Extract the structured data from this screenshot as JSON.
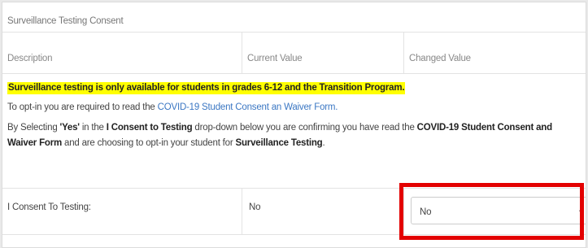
{
  "panel": {
    "title": "Surveillance Testing Consent"
  },
  "table_header": {
    "description": "Description",
    "current_value": "Current Value",
    "changed_value": "Changed Value"
  },
  "notice": "Surveillance testing is only available for students in grades 6-12 and the Transition Program.",
  "optin": {
    "prefix": "To opt-in you are required to read the ",
    "link_text": "COVID-19 Student Consent an Waiver Form."
  },
  "instructions": {
    "p1": "By Selecting ",
    "yes": "'Yes'",
    "p2": " in the ",
    "field": "I Consent to Testing",
    "p3": " drop-down below you are confirming you have read the ",
    "form": "COVID-19 Student Consent and Waiver Form",
    "p4": " and are choosing to opt-in your student for ",
    "testing": "Surveillance Testing",
    "p5": "."
  },
  "consent": {
    "label": "I Consent To Testing:",
    "current_value": "No",
    "selected_value": "No"
  },
  "colors": {
    "notice_highlight": "#ffff00",
    "link": "#3b77c3",
    "annotation_box": "#e30000"
  }
}
